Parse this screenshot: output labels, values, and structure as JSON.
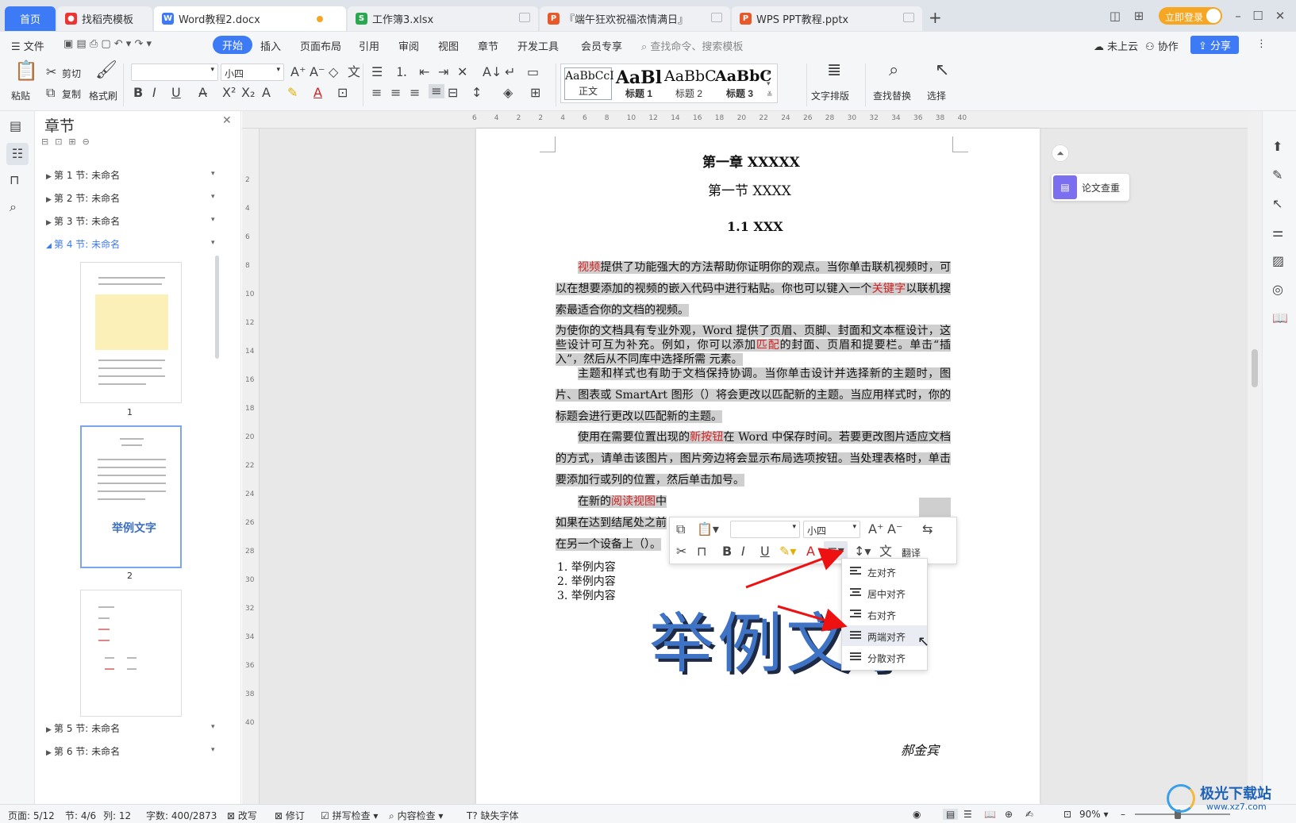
{
  "tabs": {
    "home": "首页",
    "t1": "找稻壳模板",
    "t2": "Word教程2.docx",
    "t3": "工作簿3.xlsx",
    "t4": "『端午狂欢祝福浓情满日』",
    "t5": "WPS PPT教程.pptx",
    "new_tab": "+"
  },
  "titlebar": {
    "login": "立即登录"
  },
  "menu": {
    "file": "文件",
    "start": "开始",
    "insert": "插入",
    "layout": "页面布局",
    "ref": "引用",
    "review": "审阅",
    "view": "视图",
    "chapter": "章节",
    "dev": "开发工具",
    "member": "会员专享",
    "search": "查找命令、搜索模板",
    "cloud": "未上云",
    "collab": "协作",
    "share": "分享"
  },
  "ribbon": {
    "paste": "粘贴",
    "cut": "剪切",
    "copy": "复制",
    "format_painter": "格式刷",
    "font_size": "小四",
    "styles": [
      {
        "preview": "AaBbCcI",
        "label": "正文"
      },
      {
        "preview": "AaBl",
        "label": "标题 1"
      },
      {
        "preview": "AaBbC",
        "label": "标题 2"
      },
      {
        "preview": "AaBbC",
        "label": "标题 3"
      }
    ],
    "text_layout": "文字排版",
    "find_replace": "查找替换",
    "select": "选择"
  },
  "nav": {
    "title": "章节",
    "sections": [
      "第 1 节: 未命名",
      "第 2 节: 未命名",
      "第 3 节: 未命名",
      "第 4 节: 未命名"
    ],
    "sections_after": [
      "第 5 节: 未命名",
      "第 6 节: 未命名"
    ],
    "thumb_labels": [
      "1",
      "2"
    ],
    "thumb2_title": "举例文字"
  },
  "ruler": {
    "h": [
      "6",
      "4",
      "2",
      "2",
      "4",
      "6",
      "8",
      "10",
      "12",
      "14",
      "16",
      "18",
      "20",
      "22",
      "24",
      "26",
      "28",
      "30",
      "32",
      "34",
      "36",
      "38",
      "40"
    ],
    "v": [
      "2",
      "4",
      "6",
      "8",
      "10",
      "12",
      "14",
      "16",
      "18",
      "20",
      "22",
      "24",
      "26",
      "28",
      "30",
      "32",
      "34",
      "36",
      "38",
      "40"
    ]
  },
  "doc": {
    "chapter": "第一章 XXXXX",
    "section": "第一节 XXXX",
    "sub": "1.1 XXX",
    "p1": [
      {
        "t": "视频",
        "red": true
      },
      {
        "t": "提供了功能强大的方法帮助你证明你的观点。当你单击联机视频时，可以在想要添加的视频的嵌入代码中进行粘贴。你也可以键入一个"
      },
      {
        "t": "关键字",
        "red": true
      },
      {
        "t": "以联机搜索最适合你的文档的视频。"
      }
    ],
    "p2": [
      {
        "t": "为使你的文档具有专业外观，Word 提供了页眉、页脚、封面和文本框设计，这些设计可互为补充。例如，你可以添加"
      },
      {
        "t": "匹配",
        "red": true
      },
      {
        "t": "的封面、页眉和提要栏。单击“插入”，然后从不同库中选择所需 元素。"
      }
    ],
    "p3": [
      {
        "t": "主题和样式也有助于文档保持协调。当你单击设计并选择新的主题时，图片、图表或 SmartArt 图形（）将会更改以匹配新的主题。当应用样式时，你的标题会进行更改以匹配新的主题。"
      }
    ],
    "p4": [
      {
        "t": "使用在需要位置出现的"
      },
      {
        "t": "新按钮",
        "red": true
      },
      {
        "t": "在 Word 中保存时间。若要更改图片适应文档的方式，请单击该图片，图片旁边将会显示布局选项按钮。当处理表格时，单击要添加行或列的位置，然后单击加号。"
      }
    ],
    "p5a": [
      {
        "t": "在新的"
      },
      {
        "t": "阅读视图",
        "red": true
      },
      {
        "t": "中"
      }
    ],
    "p5b": "如果在达到结尾处之前",
    "p5c": "在另一个设备上（）。",
    "list": [
      "1. 举例内容",
      "2. 举例内容",
      "3. 举例内容"
    ],
    "art": "举例文字",
    "signature": "郝金宾"
  },
  "float_btn": "论文查重",
  "mini": {
    "font_size": "小四",
    "translate": "翻译"
  },
  "dropdown": [
    "左对齐",
    "居中对齐",
    "右对齐",
    "两端对齐",
    "分散对齐"
  ],
  "status": {
    "page": "页面: 5/12",
    "sec": "节: 4/6",
    "col": "列: 12",
    "words": "字数: 400/2873",
    "overwrite": "改写",
    "revise": "修订",
    "spell": "拼写检查",
    "content": "内容检查",
    "missing_font": "缺失字体",
    "zoom": "90%"
  },
  "watermark": {
    "name": "极光下载站",
    "url": "www.xz7.com"
  }
}
